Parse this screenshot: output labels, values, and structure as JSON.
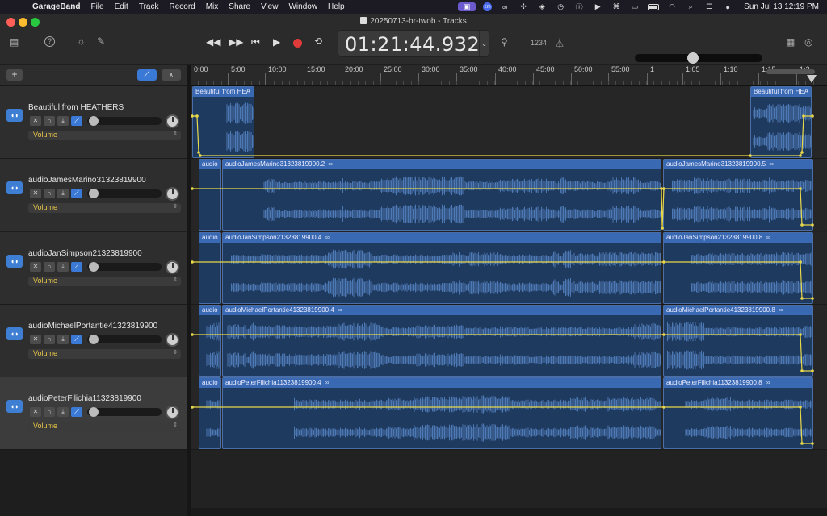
{
  "menubar": {
    "app_name": "GarageBand",
    "items": [
      "File",
      "Edit",
      "Track",
      "Record",
      "Mix",
      "Share",
      "View",
      "Window",
      "Help"
    ],
    "clock": "Sun Jul 13  12:19 PM",
    "status_icons": [
      "screen-record-icon",
      "zoom-icon",
      "creative-cloud-icon",
      "control-icon",
      "dropbox-icon",
      "time-machine-icon",
      "info-icon",
      "play-circle-icon",
      "command-icon",
      "display-icon",
      "battery-icon",
      "wifi-icon",
      "search-icon",
      "control-center-icon",
      "siri-icon"
    ]
  },
  "window": {
    "title": "20250713-br-twob - Tracks",
    "lcd_time": "01:21:44.932",
    "count_in": "1234",
    "volume_level": 0.45
  },
  "header": {
    "add_label": "+",
    "tracks": [
      {
        "name": "Beautiful from HEATHERS",
        "automation": "Volume",
        "selected": false
      },
      {
        "name": "audioJamesMarino31323819900",
        "automation": "Volume",
        "selected": false
      },
      {
        "name": "audioJanSimpson21323819900",
        "automation": "Volume",
        "selected": false
      },
      {
        "name": "audioMichaelPortantie41323819900",
        "automation": "Volume",
        "selected": false
      },
      {
        "name": "audioPeterFilichia11323819900",
        "automation": "Volume",
        "selected": true
      }
    ]
  },
  "ruler": {
    "labels": [
      "0:00",
      "5:00",
      "10:00",
      "15:00",
      "20:00",
      "25:00",
      "30:00",
      "35:00",
      "40:00",
      "45:00",
      "50:00",
      "55:00",
      "1",
      "1:05",
      "1:10",
      "1:15",
      "1:2"
    ]
  },
  "regions": [
    [
      {
        "label": "Beautiful from HEA",
        "loop": false
      },
      {
        "label": "Beautiful from HEA",
        "loop": false
      }
    ],
    [
      {
        "label": "audio",
        "loop": false
      },
      {
        "label": "audioJamesMarino31323819900.2",
        "loop": true
      },
      {
        "label": "audioJamesMarino31323819900.5",
        "loop": true
      }
    ],
    [
      {
        "label": "audio",
        "loop": false
      },
      {
        "label": "audioJanSimpson21323819900.4",
        "loop": true
      },
      {
        "label": "audioJanSimpson21323819900.8",
        "loop": true
      }
    ],
    [
      {
        "label": "audio",
        "loop": false
      },
      {
        "label": "audioMichaelPortantie41323819900.4",
        "loop": true
      },
      {
        "label": "audioMichaelPortantie41323819900.8",
        "loop": true
      }
    ],
    [
      {
        "label": "audio",
        "loop": false
      },
      {
        "label": "audioPeterFilichia11323819900.4",
        "loop": true
      },
      {
        "label": "audioPeterFilichia11323819900.8",
        "loop": true
      }
    ]
  ],
  "colors": {
    "region_header": "#3a69b3",
    "region_body": "#1f3a5f",
    "automation_line": "#e8d84a",
    "record": "#e03b3b",
    "accent": "#3b79d6"
  }
}
